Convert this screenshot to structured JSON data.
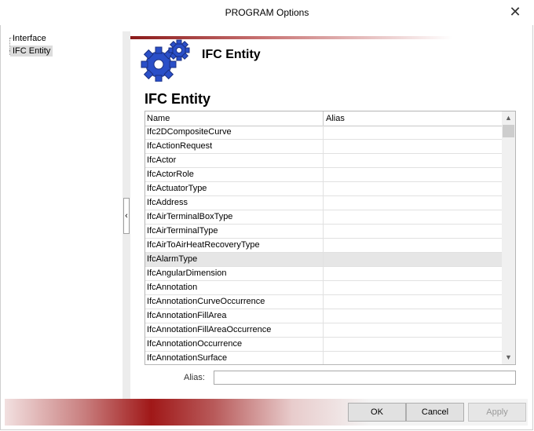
{
  "window": {
    "title": "PROGRAM Options"
  },
  "tree": {
    "items": [
      {
        "label": "Interface"
      },
      {
        "label": "IFC Entity",
        "selected": true
      }
    ]
  },
  "header": {
    "title": "IFC Entity"
  },
  "section": {
    "title": "IFC Entity"
  },
  "grid": {
    "columns": [
      "Name",
      "Alias"
    ],
    "rows": [
      {
        "name": "Ifc2DCompositeCurve",
        "alias": ""
      },
      {
        "name": "IfcActionRequest",
        "alias": ""
      },
      {
        "name": "IfcActor",
        "alias": ""
      },
      {
        "name": "IfcActorRole",
        "alias": ""
      },
      {
        "name": "IfcActuatorType",
        "alias": ""
      },
      {
        "name": "IfcAddress",
        "alias": ""
      },
      {
        "name": "IfcAirTerminalBoxType",
        "alias": ""
      },
      {
        "name": "IfcAirTerminalType",
        "alias": ""
      },
      {
        "name": "IfcAirToAirHeatRecoveryType",
        "alias": ""
      },
      {
        "name": "IfcAlarmType",
        "alias": "",
        "highlighted": true
      },
      {
        "name": "IfcAngularDimension",
        "alias": ""
      },
      {
        "name": "IfcAnnotation",
        "alias": ""
      },
      {
        "name": "IfcAnnotationCurveOccurrence",
        "alias": ""
      },
      {
        "name": "IfcAnnotationFillArea",
        "alias": ""
      },
      {
        "name": "IfcAnnotationFillAreaOccurrence",
        "alias": ""
      },
      {
        "name": "IfcAnnotationOccurrence",
        "alias": ""
      },
      {
        "name": "IfcAnnotationSurface",
        "alias": ""
      }
    ]
  },
  "alias_field": {
    "label": "Alias:",
    "value": ""
  },
  "buttons": {
    "ok": "OK",
    "cancel": "Cancel",
    "apply": "Apply"
  },
  "icons": {
    "close": "close-icon",
    "gears": "gears-icon",
    "collapse": "chevron-left-icon",
    "scroll_up": "scroll-up-icon",
    "scroll_down": "scroll-down-icon"
  },
  "colors": {
    "accent": "#a01818",
    "gear_blue": "#2a4fc8",
    "selection": "#dcdcdc"
  }
}
